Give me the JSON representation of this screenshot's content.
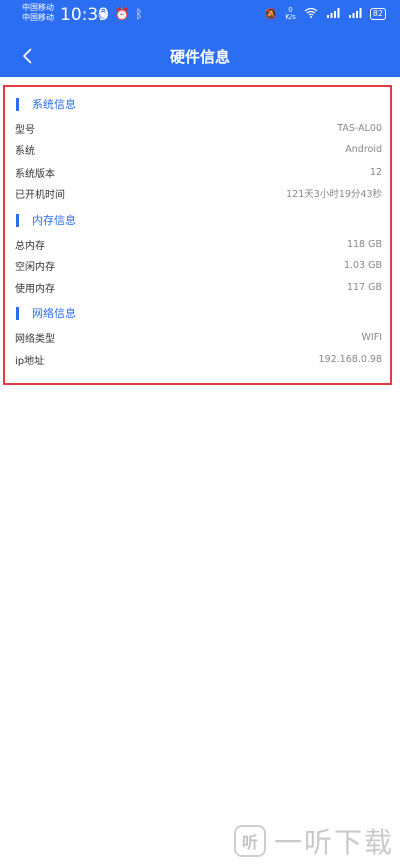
{
  "status_bar": {
    "carrier_1": "中国移动",
    "carrier_2": "中国移动",
    "time": "10:39",
    "net_speed_value": "0",
    "net_speed_unit": "K/s",
    "battery": "82"
  },
  "header": {
    "title": "硬件信息"
  },
  "sections": {
    "system": {
      "title": "系统信息",
      "rows": [
        {
          "label": "型号",
          "value": "TAS-AL00"
        },
        {
          "label": "系统",
          "value": "Android"
        },
        {
          "label": "系统版本",
          "value": "12"
        },
        {
          "label": "已开机时间",
          "value": "121天3小时19分43秒"
        }
      ]
    },
    "memory": {
      "title": "内存信息",
      "rows": [
        {
          "label": "总内存",
          "value": "118 GB"
        },
        {
          "label": "空闲内存",
          "value": "1.03 GB"
        },
        {
          "label": "使用内存",
          "value": "117 GB"
        }
      ]
    },
    "network": {
      "title": "网络信息",
      "rows": [
        {
          "label": "网络类型",
          "value": "WIFI"
        },
        {
          "label": "ip地址",
          "value": "192.168.0.98"
        }
      ]
    }
  },
  "watermark": {
    "text": "一听下载",
    "logo_glyph": "听"
  },
  "colors": {
    "header_bg": "#2c6ef2",
    "accent": "#2c6ef2",
    "highlight_border": "#e23b42"
  }
}
